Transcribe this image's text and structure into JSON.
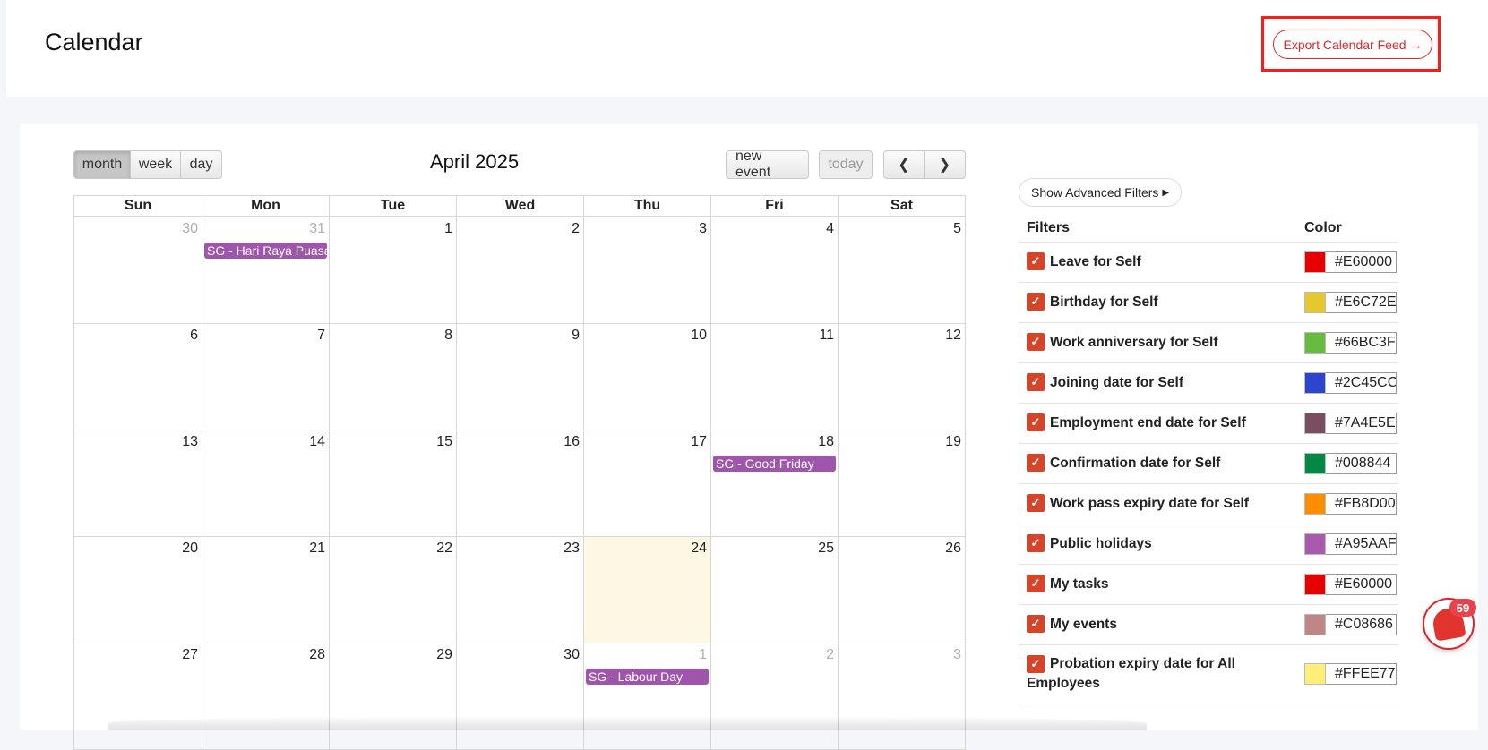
{
  "header": {
    "title": "Calendar",
    "export_label": "Export Calendar Feed"
  },
  "toolbar": {
    "views": [
      "month",
      "week",
      "day"
    ],
    "active_view": "month",
    "title": "April 2025",
    "new_event": "new event",
    "today": "today"
  },
  "calendar": {
    "dow": [
      "Sun",
      "Mon",
      "Tue",
      "Wed",
      "Thu",
      "Fri",
      "Sat"
    ],
    "weeks": [
      [
        {
          "n": "30",
          "other": true
        },
        {
          "n": "31",
          "other": true,
          "event": "SG - Hari Raya Puasa"
        },
        {
          "n": "1"
        },
        {
          "n": "2"
        },
        {
          "n": "3"
        },
        {
          "n": "4"
        },
        {
          "n": "5"
        }
      ],
      [
        {
          "n": "6"
        },
        {
          "n": "7"
        },
        {
          "n": "8"
        },
        {
          "n": "9"
        },
        {
          "n": "10"
        },
        {
          "n": "11"
        },
        {
          "n": "12"
        }
      ],
      [
        {
          "n": "13"
        },
        {
          "n": "14"
        },
        {
          "n": "15"
        },
        {
          "n": "16"
        },
        {
          "n": "17"
        },
        {
          "n": "18",
          "event": "SG - Good Friday"
        },
        {
          "n": "19"
        }
      ],
      [
        {
          "n": "20"
        },
        {
          "n": "21"
        },
        {
          "n": "22"
        },
        {
          "n": "23"
        },
        {
          "n": "24",
          "today": true
        },
        {
          "n": "25"
        },
        {
          "n": "26"
        }
      ],
      [
        {
          "n": "27"
        },
        {
          "n": "28"
        },
        {
          "n": "29"
        },
        {
          "n": "30"
        },
        {
          "n": "1",
          "other": true,
          "event": "SG - Labour Day"
        },
        {
          "n": "2",
          "other": true
        },
        {
          "n": "3",
          "other": true
        }
      ]
    ],
    "event_color": "#A055AC",
    "today_color": "#FCF8E3"
  },
  "filters": {
    "advanced_label": "Show Advanced Filters",
    "col_filters": "Filters",
    "col_color": "Color",
    "items": [
      {
        "label": "Leave for Self",
        "hex": "#E60000",
        "color": "#E60000"
      },
      {
        "label": "Birthday for Self",
        "hex": "#E6C72E",
        "color": "#E6C72E"
      },
      {
        "label": "Work anniversary for Self",
        "hex": "#66BC3F",
        "color": "#66BC3F"
      },
      {
        "label": "Joining date for Self",
        "hex": "#2C45CC",
        "color": "#2C45CC"
      },
      {
        "label": "Employment end date for Self",
        "hex": "#7A4E5E",
        "color": "#7A4E5E"
      },
      {
        "label": "Confirmation date for Self",
        "hex": "#008844",
        "color": "#008844"
      },
      {
        "label": "Work pass expiry date for Self",
        "hex": "#FB8D00",
        "color": "#FB8D00"
      },
      {
        "label": "Public holidays",
        "hex": "#A95AAF",
        "color": "#A95AAF"
      },
      {
        "label": "My tasks",
        "hex": "#E60000",
        "color": "#E60000"
      },
      {
        "label": "My events",
        "hex": "#C08686",
        "color": "#C08686"
      },
      {
        "label": "Probation expiry date for All Employees",
        "hex": "#FFEE77",
        "color": "#FFEE77"
      }
    ]
  },
  "notifications": {
    "count": "59"
  }
}
